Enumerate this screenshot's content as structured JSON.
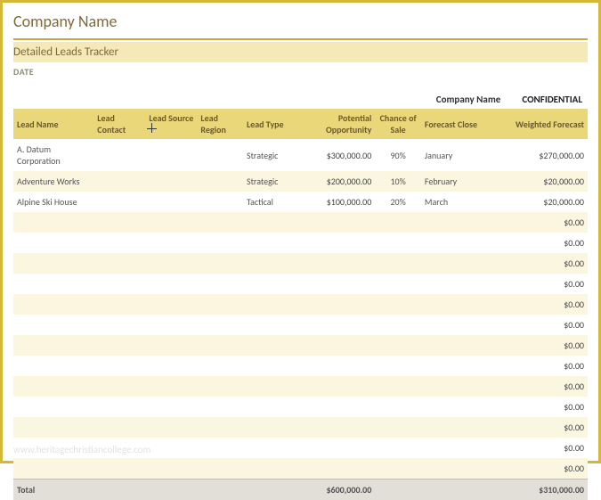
{
  "header": {
    "title": "Company Name",
    "subtitle": "Detailed Leads Tracker",
    "date_label": "DATE"
  },
  "superheader": {
    "company": "Company Name",
    "confidential": "CONFIDENTIAL"
  },
  "columns": {
    "lead_name": "Lead Name",
    "lead_contact": "Lead Contact",
    "lead_source": "Lead Source",
    "lead_region": "Lead Region",
    "lead_type": "Lead Type",
    "potential": "Potential Opportunity",
    "chance": "Chance of Sale",
    "forecast_close": "Forecast Close",
    "weighted": "Weighted Forecast"
  },
  "rows": [
    {
      "lead_name": "A. Datum Corporation",
      "lead_contact": "",
      "lead_source": "",
      "lead_region": "",
      "lead_type": "Strategic",
      "potential": "$300,000.00",
      "chance": "90%",
      "forecast_close": "January",
      "weighted": "$270,000.00"
    },
    {
      "lead_name": "Adventure Works",
      "lead_contact": "",
      "lead_source": "",
      "lead_region": "",
      "lead_type": "Strategic",
      "potential": "$200,000.00",
      "chance": "10%",
      "forecast_close": "February",
      "weighted": "$20,000.00"
    },
    {
      "lead_name": "Alpine Ski House",
      "lead_contact": "",
      "lead_source": "",
      "lead_region": "",
      "lead_type": "Tactical",
      "potential": "$100,000.00",
      "chance": "20%",
      "forecast_close": "March",
      "weighted": "$20,000.00"
    },
    {
      "lead_name": "",
      "lead_contact": "",
      "lead_source": "",
      "lead_region": "",
      "lead_type": "",
      "potential": "",
      "chance": "",
      "forecast_close": "",
      "weighted": "$0.00"
    },
    {
      "lead_name": "",
      "lead_contact": "",
      "lead_source": "",
      "lead_region": "",
      "lead_type": "",
      "potential": "",
      "chance": "",
      "forecast_close": "",
      "weighted": "$0.00"
    },
    {
      "lead_name": "",
      "lead_contact": "",
      "lead_source": "",
      "lead_region": "",
      "lead_type": "",
      "potential": "",
      "chance": "",
      "forecast_close": "",
      "weighted": "$0.00"
    },
    {
      "lead_name": "",
      "lead_contact": "",
      "lead_source": "",
      "lead_region": "",
      "lead_type": "",
      "potential": "",
      "chance": "",
      "forecast_close": "",
      "weighted": "$0.00"
    },
    {
      "lead_name": "",
      "lead_contact": "",
      "lead_source": "",
      "lead_region": "",
      "lead_type": "",
      "potential": "",
      "chance": "",
      "forecast_close": "",
      "weighted": "$0.00"
    },
    {
      "lead_name": "",
      "lead_contact": "",
      "lead_source": "",
      "lead_region": "",
      "lead_type": "",
      "potential": "",
      "chance": "",
      "forecast_close": "",
      "weighted": "$0.00"
    },
    {
      "lead_name": "",
      "lead_contact": "",
      "lead_source": "",
      "lead_region": "",
      "lead_type": "",
      "potential": "",
      "chance": "",
      "forecast_close": "",
      "weighted": "$0.00"
    },
    {
      "lead_name": "",
      "lead_contact": "",
      "lead_source": "",
      "lead_region": "",
      "lead_type": "",
      "potential": "",
      "chance": "",
      "forecast_close": "",
      "weighted": "$0.00"
    },
    {
      "lead_name": "",
      "lead_contact": "",
      "lead_source": "",
      "lead_region": "",
      "lead_type": "",
      "potential": "",
      "chance": "",
      "forecast_close": "",
      "weighted": "$0.00"
    },
    {
      "lead_name": "",
      "lead_contact": "",
      "lead_source": "",
      "lead_region": "",
      "lead_type": "",
      "potential": "",
      "chance": "",
      "forecast_close": "",
      "weighted": "$0.00"
    },
    {
      "lead_name": "",
      "lead_contact": "",
      "lead_source": "",
      "lead_region": "",
      "lead_type": "",
      "potential": "",
      "chance": "",
      "forecast_close": "",
      "weighted": "$0.00"
    },
    {
      "lead_name": "",
      "lead_contact": "",
      "lead_source": "",
      "lead_region": "",
      "lead_type": "",
      "potential": "",
      "chance": "",
      "forecast_close": "",
      "weighted": "$0.00"
    },
    {
      "lead_name": "",
      "lead_contact": "",
      "lead_source": "",
      "lead_region": "",
      "lead_type": "",
      "potential": "",
      "chance": "",
      "forecast_close": "",
      "weighted": "$0.00"
    }
  ],
  "totals": {
    "label": "Total",
    "potential": "$600,000.00",
    "weighted": "$310,000.00"
  },
  "watermark": "www.heritagechristiancollege.com"
}
